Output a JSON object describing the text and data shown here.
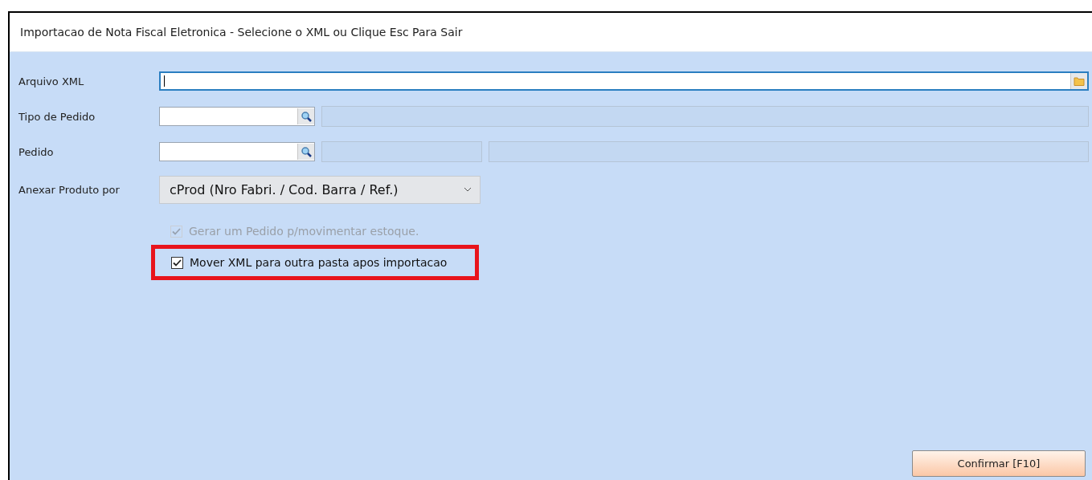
{
  "window": {
    "title": "Importacao de Nota Fiscal Eletronica - Selecione o XML ou Clique Esc Para Sair"
  },
  "fields": [
    {
      "kind": "file",
      "label": "Arquivo XML",
      "focused": true
    },
    {
      "kind": "lookup",
      "label": "Tipo de Pedido"
    },
    {
      "kind": "lookup_split",
      "label": "Pedido"
    },
    {
      "kind": "select",
      "label": "Anexar Produto por",
      "value": "cProd (Nro Fabri. / Cod. Barra / Ref.)"
    }
  ],
  "checkboxes": [
    {
      "label": "Gerar um Pedido p/movimentar estoque.",
      "checked": true,
      "disabled": true,
      "highlighted": false
    },
    {
      "label": "Mover XML para outra pasta apos importacao",
      "checked": true,
      "disabled": false,
      "highlighted": true
    }
  ],
  "buttons": [
    {
      "label": "Confirmar [F10]"
    }
  ]
}
